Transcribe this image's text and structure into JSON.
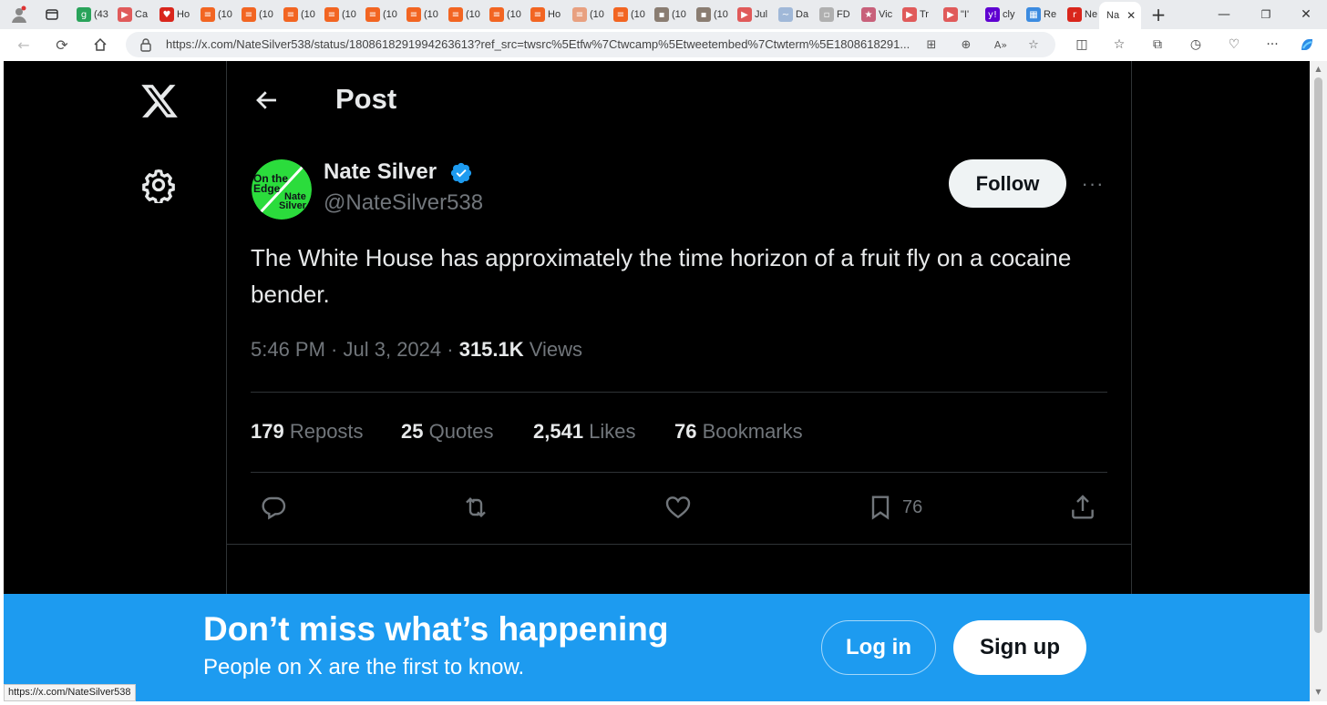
{
  "browser": {
    "tabs": [
      {
        "label": "(43",
        "color": "#29a35a",
        "glyph": "g"
      },
      {
        "label": "Ca",
        "color": "#e05a5a",
        "glyph": "▶"
      },
      {
        "label": "Ho",
        "color": "#d9261c",
        "glyph": "♥"
      },
      {
        "label": "(10",
        "color": "#f26522",
        "glyph": "≡"
      },
      {
        "label": "(10",
        "color": "#f26522",
        "glyph": "≡"
      },
      {
        "label": "(10",
        "color": "#f26522",
        "glyph": "≡"
      },
      {
        "label": "(10",
        "color": "#f26522",
        "glyph": "≡"
      },
      {
        "label": "(10",
        "color": "#f26522",
        "glyph": "≡"
      },
      {
        "label": "(10",
        "color": "#f26522",
        "glyph": "≡"
      },
      {
        "label": "(10",
        "color": "#f26522",
        "glyph": "≡"
      },
      {
        "label": "(10",
        "color": "#f26522",
        "glyph": "≡"
      },
      {
        "label": "Ho",
        "color": "#f26522",
        "glyph": "≡"
      },
      {
        "label": "(10",
        "color": "#e8a080",
        "glyph": "≡"
      },
      {
        "label": "(10",
        "color": "#f26522",
        "glyph": "≡"
      },
      {
        "label": "(10",
        "color": "#8a7d72",
        "glyph": "▪"
      },
      {
        "label": "(10",
        "color": "#8a7d72",
        "glyph": "▪"
      },
      {
        "label": "Jul",
        "color": "#e05a5a",
        "glyph": "▶"
      },
      {
        "label": "Da",
        "color": "#a0b8d8",
        "glyph": "~"
      },
      {
        "label": "FD",
        "color": "#b0b0b0",
        "glyph": "▫"
      },
      {
        "label": "Vic",
        "color": "#c8607a",
        "glyph": "★"
      },
      {
        "label": "Tr",
        "color": "#e05a5a",
        "glyph": "▶"
      },
      {
        "label": "\"I'",
        "color": "#e05a5a",
        "glyph": "▶"
      },
      {
        "label": "cly",
        "color": "#5f01d1",
        "glyph": "y!"
      },
      {
        "label": "Re",
        "color": "#3c8be0",
        "glyph": "▦"
      },
      {
        "label": "Ne",
        "color": "#d9261c",
        "glyph": "r"
      }
    ],
    "active_tab": {
      "label": "Na"
    },
    "address_url": "https://x.com/NateSilver538/status/1808618291994263613?ref_src=twsrc%5Etfw%7Ctwcamp%5Etweetembed%7Ctwterm%5E1808618291...",
    "status_url": "https://x.com/NateSilver538"
  },
  "page": {
    "header_title": "Post",
    "author": {
      "name": "Nate Silver",
      "handle": "@NateSilver538",
      "avatar_text_1": "On the",
      "avatar_text_2": "Edge",
      "avatar_text_3": "Nate",
      "avatar_text_4": "Silver",
      "avatar_color": "#2bdc3c"
    },
    "follow_label": "Follow",
    "more_label": "···",
    "tweet_text": "The White House has approximately the time horizon of a fruit fly on a cocaine bender.",
    "meta": {
      "time": "5:46 PM",
      "sep1": " · ",
      "date": "Jul 3, 2024",
      "sep2": " · ",
      "views_count": "315.1K",
      "views_label": " Views"
    },
    "stats": [
      {
        "count": "179",
        "label": " Reposts"
      },
      {
        "count": "25",
        "label": " Quotes"
      },
      {
        "count": "2,541",
        "label": " Likes"
      },
      {
        "count": "76",
        "label": " Bookmarks"
      }
    ],
    "actions": {
      "bookmark_count": "76"
    },
    "banner": {
      "title": "Don’t miss what’s happening",
      "subtitle": "People on X are the first to know.",
      "login_label": "Log in",
      "signup_label": "Sign up"
    },
    "colors": {
      "background": "#000000",
      "accent": "#1d9bf0",
      "text_primary": "#e7e9ea",
      "text_secondary": "#71767b"
    }
  }
}
